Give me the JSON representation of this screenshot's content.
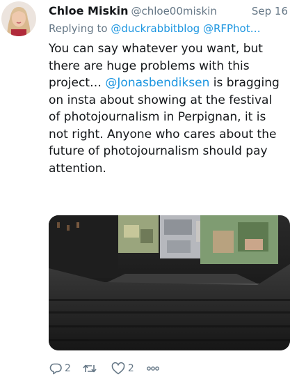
{
  "tweet": {
    "author_name": "Chloe Miskin",
    "handle": "@chloe00miskin",
    "date": "Sep 16",
    "reply_prefix": "Replying to",
    "reply_to": [
      "@duckrabbitblog",
      "@RFPhot…"
    ],
    "text_before": "You can say whatever you want, but there are huge problems with this project… ",
    "mention": "@Jonasbendiksen",
    "text_after": " is bragging on insta about showing at the festival of photojournalism in Perpignan, it is not right. Anyone who cares about the future of photojournalism should pay attention."
  },
  "actions": {
    "reply_count": "2",
    "retweet_count": "",
    "like_count": "2"
  },
  "icons": {
    "reply": "reply-icon",
    "retweet": "retweet-icon",
    "like": "heart-icon",
    "more": "more-icon"
  },
  "colors": {
    "link": "#1b95e0",
    "muted": "#657786",
    "text": "#14171a"
  }
}
